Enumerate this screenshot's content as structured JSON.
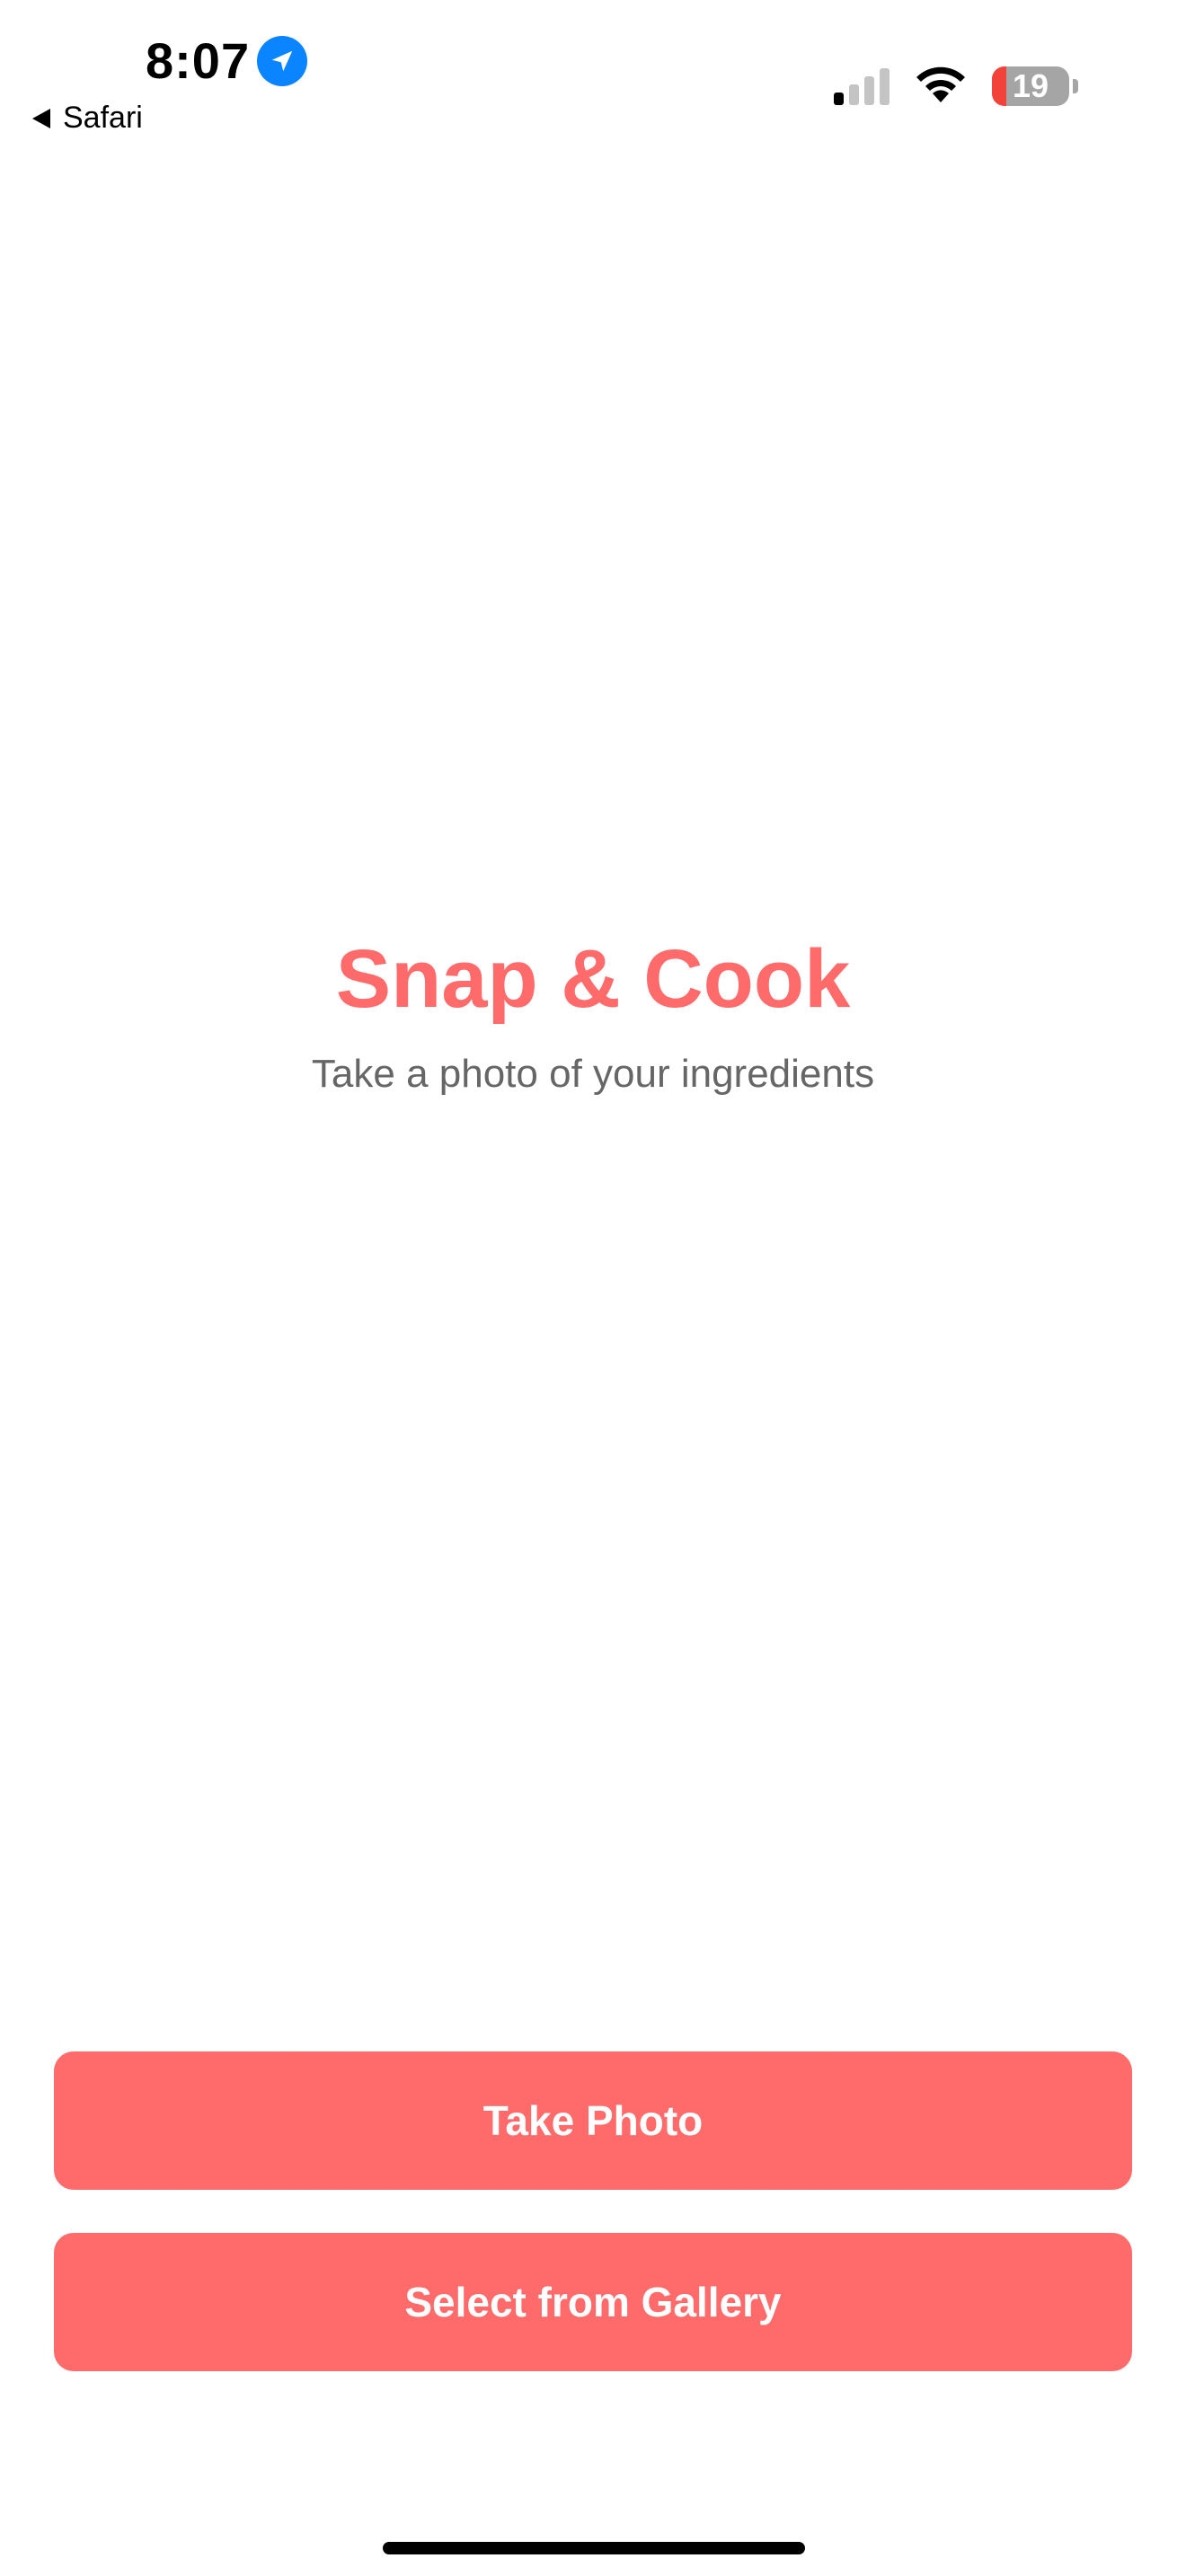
{
  "status_bar": {
    "time": "8:07",
    "back_app_label": "Safari",
    "battery_level": "19",
    "battery_fraction": 0.19,
    "signal_bars_active": 1,
    "signal_bars_total": 4,
    "location_icon": "location-arrow-icon",
    "wifi_icon": "wifi-icon"
  },
  "hero": {
    "title": "Snap & Cook",
    "subtitle": "Take a photo of your ingredients"
  },
  "actions": {
    "take_photo_label": "Take Photo",
    "gallery_label": "Select from Gallery"
  },
  "colors": {
    "accent": "#ff6b6b",
    "location_blue": "#0a84ff",
    "battery_low": "#f2423a",
    "subtitle": "#666666"
  }
}
